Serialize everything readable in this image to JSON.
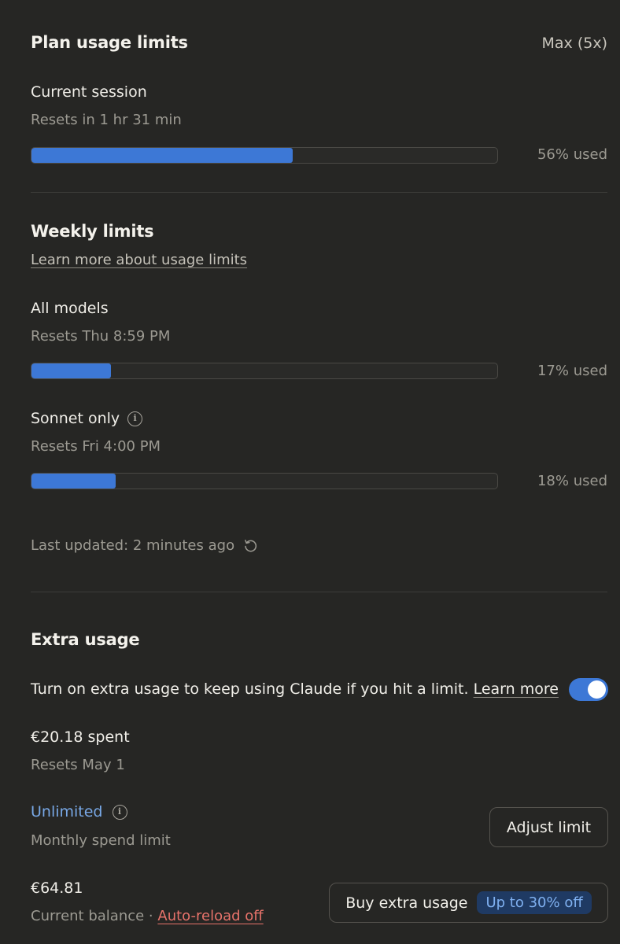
{
  "plan": {
    "title": "Plan usage limits",
    "badge": "Max (5x)",
    "current_session": {
      "title": "Current session",
      "resets": "Resets in 1 hr 31 min",
      "percent": 56,
      "used_label": "56% used"
    }
  },
  "weekly": {
    "title": "Weekly limits",
    "learn_more": "Learn more about usage limits",
    "all_models": {
      "title": "All models",
      "resets": "Resets Thu 8:59 PM",
      "percent": 17,
      "used_label": "17% used"
    },
    "sonnet": {
      "title": "Sonnet only",
      "resets": "Resets Fri 4:00 PM",
      "percent": 18,
      "used_label": "18% used"
    },
    "last_updated": "Last updated: 2 minutes ago"
  },
  "extra": {
    "title": "Extra usage",
    "description": "Turn on extra usage to keep using Claude if you hit a limit.",
    "learn_more": "Learn more",
    "toggle_on": true,
    "spent": "€20.18 spent",
    "spent_resets": "Resets May 1",
    "limit_value": "Unlimited",
    "limit_label": "Monthly spend limit",
    "adjust_button": "Adjust limit",
    "balance": "€64.81",
    "balance_label": "Current balance",
    "separator": " · ",
    "auto_reload": "Auto-reload off",
    "buy_button": "Buy extra usage",
    "promo": "Up to 30% off"
  },
  "colors": {
    "background": "#262624",
    "accent": "#3d78d6",
    "link_blue": "#78a8e6",
    "warning_red": "#e8736b"
  },
  "icons": {
    "info": "info-icon",
    "refresh": "refresh-icon"
  }
}
